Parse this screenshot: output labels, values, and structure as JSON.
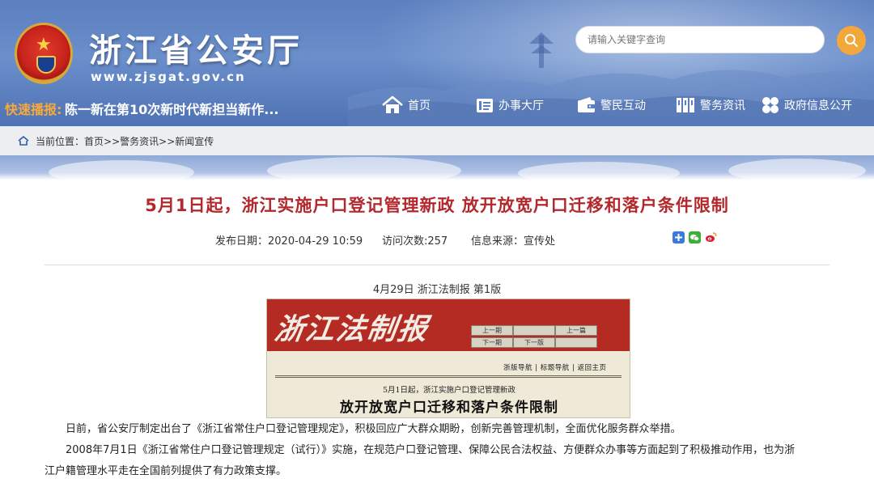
{
  "header": {
    "site_title": "浙江省公安厅",
    "site_url": "www.zjsgat.gov.cn",
    "search_placeholder": "请输入关键字查询",
    "ticker_label": "快速播报:",
    "ticker_text": "陈一新在第10次新时代新担当新作..."
  },
  "nav": [
    {
      "label": "首页",
      "icon": "home-icon"
    },
    {
      "label": "办事大厅",
      "icon": "book-icon"
    },
    {
      "label": "警民互动",
      "icon": "wallet-icon"
    },
    {
      "label": "警务资讯",
      "icon": "columns-icon"
    },
    {
      "label": "政府信息公开",
      "icon": "grid-icon"
    }
  ],
  "breadcrumb": {
    "prefix": "当前位置：",
    "items": [
      "首页>>",
      "警务资讯>>",
      "新闻宣传"
    ]
  },
  "article": {
    "title": "5月1日起，浙江实施户口登记管理新政 放开放宽户口迁移和落户条件限制",
    "publish_date": "发布日期：2020-04-29 10:59",
    "views": "访问次数:257",
    "source": "信息来源：宣传处",
    "caption": "4月29日  浙江法制报  第1版",
    "paragraphs": [
      "日前，省公安厅制定出台了《浙江省常住户口登记管理规定》，积极回应广大群众期盼，创新完善管理机制，全面优化服务群众举措。",
      "2008年7月1日《浙江省常住户口登记管理规定（试行）》实施，在规范户口登记管理、保障公民合法权益、方便群众办事等方面起到了积极推动作用，也为浙",
      "江户籍管理水平走在全国前列提供了有力政策支撑。"
    ]
  },
  "newspaper": {
    "masthead": "浙江法制报",
    "nav_cells": [
      "上一期",
      "",
      "上一篇",
      "下一期",
      "下一版",
      ""
    ],
    "subnav": "浙版导航  |  标题导航  |  返回主页",
    "kicker": "5月1日起，浙江实施户口登记管理新政",
    "headline": "放开放宽户口迁移和落户条件限制"
  },
  "colors": {
    "title_red": "#b3282d",
    "ticker_orange": "#f7a93a",
    "search_button": "#f2a73a",
    "header_blue": "#5b7fbf"
  }
}
